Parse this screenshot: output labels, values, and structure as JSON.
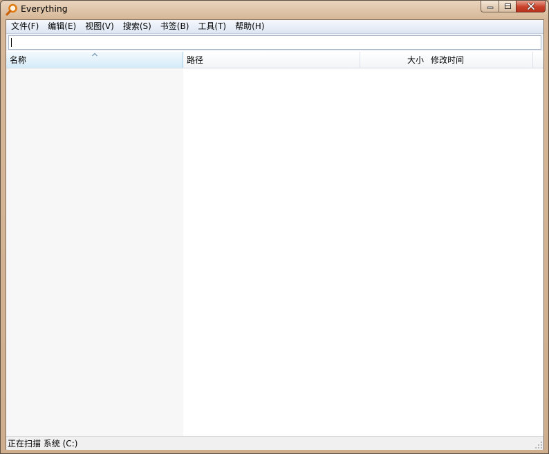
{
  "window": {
    "title": "Everything"
  },
  "menu": {
    "items": [
      {
        "label": "文件(F)"
      },
      {
        "label": "编辑(E)"
      },
      {
        "label": "视图(V)"
      },
      {
        "label": "搜索(S)"
      },
      {
        "label": "书签(B)"
      },
      {
        "label": "工具(T)"
      },
      {
        "label": "帮助(H)"
      }
    ]
  },
  "search": {
    "value": ""
  },
  "columns": {
    "name": "名称",
    "path": "路径",
    "size": "大小",
    "modified": "修改时间",
    "sorted_by": "name",
    "sort_direction": "ascending"
  },
  "results": [],
  "status": {
    "text": "正在扫描 系统 (C:)"
  },
  "icons": {
    "app": "magnifier-icon",
    "minimize": "minimize-icon",
    "maximize": "maximize-icon",
    "close": "close-icon",
    "sort": "sort-ascending-icon",
    "grip": "resize-grip-icon"
  },
  "colors": {
    "app_icon": "#e07a10",
    "header_selected": "#d4ebf8",
    "menubar": "#dde6f3",
    "close_button": "#c9412a"
  }
}
